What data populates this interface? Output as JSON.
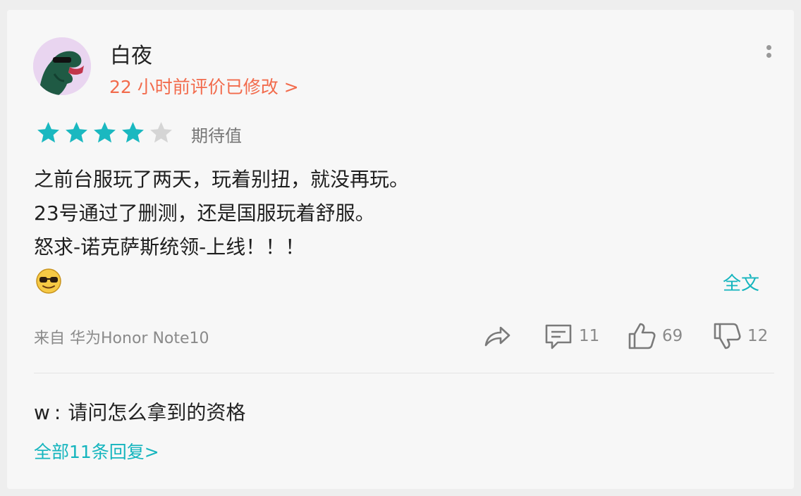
{
  "review": {
    "username": "白夜",
    "edit_meta": "22 小时前评价已修改 >",
    "rating": 4,
    "rating_max": 5,
    "rating_label": "期待值",
    "body_lines": [
      "之前台服玩了两天，玩着别扭，就没再玩。",
      "23号通过了删测，还是国服玩着舒服。",
      "怒求-诺克萨斯统领-上线！！！"
    ],
    "emoji": "sunglasses-emoji",
    "fulltext_label": "全文",
    "device": "来自 华为Honor Note10",
    "actions": {
      "share_icon": "share-icon",
      "comment_count": "11",
      "like_count": "69",
      "dislike_count": "12"
    }
  },
  "reply": {
    "user": "w",
    "separator": ":",
    "text": "请问怎么拿到的资格",
    "all_replies_label": "全部11条回复>"
  },
  "colors": {
    "star_filled": "#1ab8c0",
    "star_empty": "#d5d5d5",
    "accent_link": "#15b5be",
    "edit_meta": "#f26b4c"
  }
}
